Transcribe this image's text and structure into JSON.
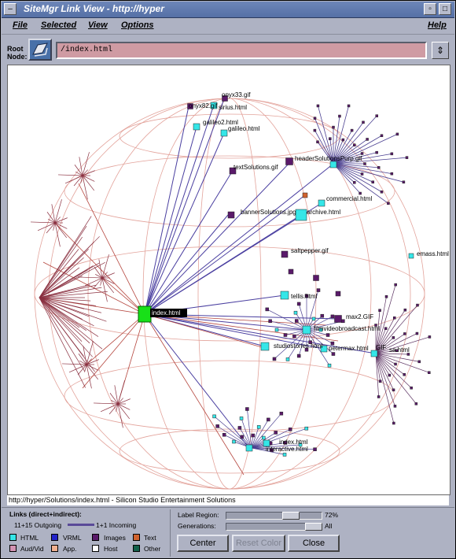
{
  "window": {
    "title": "SiteMgr Link View - http://hyper"
  },
  "menubar": {
    "file": "File",
    "selected": "Selected",
    "view": "View",
    "options": "Options",
    "help": "Help"
  },
  "root": {
    "label_line1": "Root",
    "label_line2": "Node:",
    "value": "/index.html",
    "button_icon": "folder-open-icon"
  },
  "graph": {
    "center_label": "index.html",
    "node_labels": [
      "onyx33.gif",
      "onyx82.gif",
      "sirius.html",
      "galileo2.html",
      "galileo.html",
      "textSolutions.gif",
      "headerSolutionsPurp.gif",
      "commercial.html",
      "bannerSolutions.jpg",
      "archive.html",
      "saltpepper.gif",
      "emass.html",
      "tellis.html",
      "max2.GIF",
      "filmvideobroadcast.html",
      "studiostories.html",
      "petermax.html",
      "GIF",
      "sa.html",
      "index.html",
      "interactive.html"
    ]
  },
  "status": {
    "text": "http://hyper/Solutions/index.html - Silicon Studio Entertainment Solutions"
  },
  "links": {
    "heading": "Links (direct+indirect):",
    "outgoing": "11+15 Outgoing",
    "incoming": "1+1 Incoming",
    "legend": [
      "HTML",
      "VRML",
      "Images",
      "Text",
      "Aud/Vid",
      "App.",
      "Host",
      "Other"
    ],
    "colors": {
      "html": "#35e6e8",
      "vrml": "#2323c8",
      "images": "#5a1a6a",
      "text": "#d0622e",
      "audvid": "#d393b3",
      "app": "#f0b090",
      "host": "#ffffff",
      "other": "#12604a"
    }
  },
  "controls": {
    "label_region": "Label Region:",
    "label_region_value": "72%",
    "label_region_fraction": 0.72,
    "generations": "Generations:",
    "generations_value": "All",
    "center_button": "Center",
    "reset_color_button": "Reset Color",
    "close_button": "Close"
  }
}
